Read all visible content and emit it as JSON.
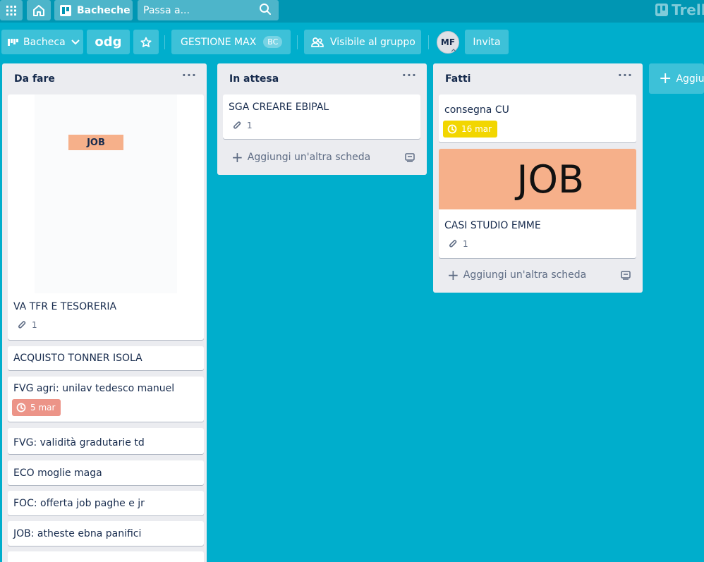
{
  "nav": {
    "boards_label": "Bacheche",
    "search_placeholder": "Passa a...",
    "logo_text": "Trello"
  },
  "header": {
    "board_menu_label": "Bacheca",
    "board_title": "odg",
    "team_label": "GESTIONE MAX",
    "team_badge": "BC",
    "visibility_label": "Visibile al gruppo",
    "member_initials": "MF",
    "invite_label": "Invita"
  },
  "lists": [
    {
      "title": "Da fare",
      "cards": [
        {
          "cover_text": "JOB",
          "title": "VA TFR E TESORERIA",
          "attachments": "1"
        },
        {
          "title": "ACQUISTO TONNER ISOLA"
        },
        {
          "title": "FVG agri: unilav tedesco manuel",
          "due": "5 mar"
        },
        {
          "title": "FVG: validità gradutarie td"
        },
        {
          "title": "ECO moglie maga"
        },
        {
          "title": "FOC: offerta job paghe e jr"
        },
        {
          "title": "JOB: atheste ebna panifici"
        }
      ]
    },
    {
      "title": "In attesa",
      "cards": [
        {
          "title": "SGA CREARE EBIPAL",
          "attachments": "1"
        }
      ],
      "add_card_label": "Aggiungi un'altra scheda"
    },
    {
      "title": "Fatti",
      "cards": [
        {
          "title": "consegna CU",
          "due": "16 mar"
        },
        {
          "cover_text": "JOB",
          "title": "CASI STUDIO EMME",
          "attachments": "1"
        }
      ],
      "add_card_label": "Aggiungi un'altra scheda"
    }
  ],
  "add_list_label": "Aggiungi un'altra lista",
  "colors": {
    "board_bg": "#00aecc",
    "nav_bg": "#0096b3",
    "list_bg": "#ebecf0",
    "cover_orange": "#f6b08a",
    "due_overdue": "#ec9488",
    "due_soon": "#f2d600"
  },
  "icons": {
    "apps": "apps-grid-icon",
    "home": "home-icon",
    "boards": "boards-icon",
    "search": "search-icon",
    "board_menu": "board-menu-icon",
    "chevron": "chevron-down-icon",
    "star": "star-icon",
    "visibility": "team-visibility-icon",
    "attachment": "paperclip-icon",
    "clock": "clock-icon",
    "template": "card-template-icon"
  }
}
